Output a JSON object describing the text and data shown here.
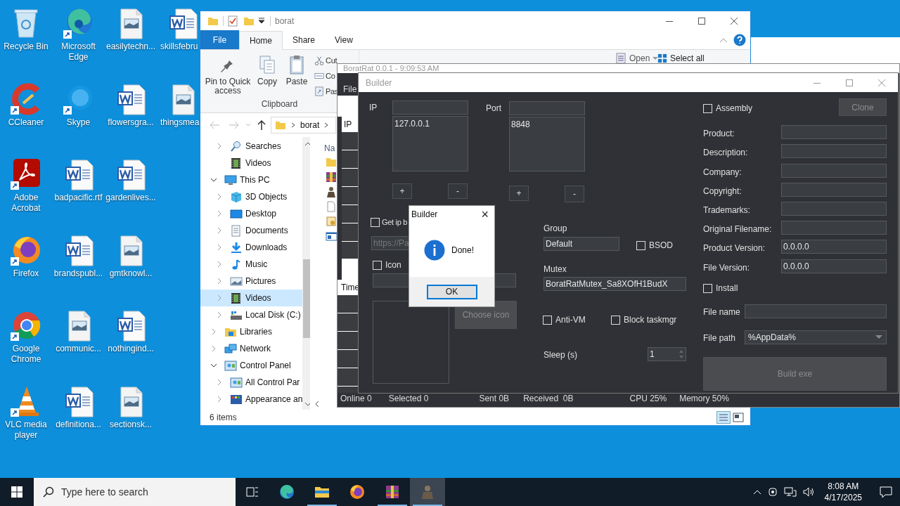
{
  "desktop": {
    "columns": [
      [
        {
          "label": "Recycle Bin",
          "kind": "recycle-bin",
          "shortcut": false
        },
        {
          "label": "CCleaner",
          "kind": "ccleaner",
          "shortcut": true
        },
        {
          "label": "Adobe Acrobat",
          "kind": "acrobat",
          "shortcut": true
        },
        {
          "label": "Firefox",
          "kind": "firefox",
          "shortcut": true
        },
        {
          "label": "Google Chrome",
          "kind": "chrome",
          "shortcut": true
        },
        {
          "label": "VLC media player",
          "kind": "vlc",
          "shortcut": true
        }
      ],
      [
        {
          "label": "Microsoft Edge",
          "kind": "edge",
          "shortcut": true
        },
        {
          "label": "Skype",
          "kind": "skype",
          "shortcut": true
        },
        {
          "label": "badpacific.rtf",
          "kind": "word",
          "shortcut": false
        },
        {
          "label": "brandspubl...",
          "kind": "word",
          "shortcut": false
        },
        {
          "label": "communic...",
          "kind": "image",
          "shortcut": false
        },
        {
          "label": "definitiona...",
          "kind": "word",
          "shortcut": false
        }
      ],
      [
        {
          "label": "easilytechn...",
          "kind": "image",
          "shortcut": false
        },
        {
          "label": "flowersgra...",
          "kind": "word",
          "shortcut": false
        },
        {
          "label": "gardenlives...",
          "kind": "word",
          "shortcut": false
        },
        {
          "label": "gmtknowl...",
          "kind": "image",
          "shortcut": false
        },
        {
          "label": "nothingind...",
          "kind": "word",
          "shortcut": false
        },
        {
          "label": "sectionsk...",
          "kind": "image",
          "shortcut": false
        }
      ],
      [
        {
          "label": "skillsfebru",
          "kind": "word",
          "shortcut": false
        },
        {
          "label": "thingsmea",
          "kind": "image",
          "shortcut": false
        }
      ]
    ]
  },
  "explorer": {
    "title": "borat",
    "tabs": [
      {
        "label": "File",
        "kind": "file",
        "selected": false
      },
      {
        "label": "Home",
        "kind": "tab",
        "selected": true
      },
      {
        "label": "Share",
        "kind": "tab",
        "selected": false
      },
      {
        "label": "View",
        "kind": "tab",
        "selected": false
      }
    ],
    "clipboard": {
      "large_buttons": [
        {
          "label": "Pin to Quick access",
          "kind": "pin"
        },
        {
          "label": "Copy",
          "kind": "copy"
        },
        {
          "label": "Paste",
          "kind": "paste"
        }
      ],
      "small_buttons": [
        {
          "label": "Cut",
          "kind": "cut"
        },
        {
          "label": "Co",
          "kind": "copypath"
        },
        {
          "label": "Pas",
          "kind": "shortcut"
        }
      ],
      "group_label": "Clipboard"
    },
    "open_button": "Open",
    "select_all_button": "Select all",
    "address": "borat",
    "quick_access_items": [
      {
        "label": "Searches",
        "kind": "search",
        "has_children": true,
        "expanded": false,
        "selected": false
      },
      {
        "label": "Videos",
        "kind": "video",
        "has_children": false,
        "selected": false
      }
    ],
    "nav_items": [
      {
        "label": "This PC",
        "kind": "pc",
        "has_children": true,
        "expanded": true,
        "selected": false,
        "children": [
          {
            "label": "3D Objects",
            "kind": "cube",
            "has_children": true,
            "expanded": false,
            "selected": false
          },
          {
            "label": "Desktop",
            "kind": "desktop",
            "has_children": true,
            "expanded": false,
            "selected": false
          },
          {
            "label": "Documents",
            "kind": "document",
            "has_children": true,
            "expanded": false,
            "selected": false
          },
          {
            "label": "Downloads",
            "kind": "download",
            "has_children": true,
            "expanded": false,
            "selected": false
          },
          {
            "label": "Music",
            "kind": "music",
            "has_children": true,
            "expanded": false,
            "selected": false
          },
          {
            "label": "Pictures",
            "kind": "picture",
            "has_children": true,
            "expanded": false,
            "selected": false
          },
          {
            "label": "Videos",
            "kind": "video",
            "has_children": true,
            "expanded": false,
            "selected": true
          },
          {
            "label": "Local Disk (C:)",
            "kind": "disk",
            "has_children": true,
            "expanded": false,
            "selected": false
          }
        ]
      },
      {
        "label": "Libraries",
        "kind": "library",
        "has_children": true,
        "expanded": false,
        "selected": false
      },
      {
        "label": "Network",
        "kind": "network",
        "has_children": true,
        "expanded": false,
        "selected": false
      },
      {
        "label": "Control Panel",
        "kind": "control",
        "has_children": true,
        "expanded": true,
        "selected": false,
        "children": [
          {
            "label": "All Control Par",
            "kind": "control",
            "has_children": true,
            "expanded": false,
            "selected": false
          },
          {
            "label": "Appearance an",
            "kind": "appearance",
            "has_children": true,
            "expanded": false,
            "selected": false
          }
        ]
      }
    ],
    "column_header": "Na",
    "files": [
      {
        "kind": "folder"
      },
      {
        "kind": "archive"
      },
      {
        "kind": "person"
      },
      {
        "kind": "blank"
      },
      {
        "kind": "setup"
      },
      {
        "kind": "window"
      }
    ],
    "status": "6 items"
  },
  "rat_window": {
    "title": "BoratRat 0.0.1 - 9:09:53 AM",
    "menu": "File",
    "list_header": "IP",
    "log_header": "Time",
    "status_bar": [
      "Online 0",
      "Selected 0",
      "Sent 0B",
      "Received  0B",
      "CPU 25%",
      "Memory 50%"
    ]
  },
  "builder": {
    "title": "Builder",
    "ip_label": "IP",
    "ip_list": [
      "127.0.0.1"
    ],
    "port_label": "Port",
    "port_list": [
      "8848"
    ],
    "add_button": "+",
    "remove_button": "-",
    "get_ip": {
      "label": "Get ip b",
      "checked": false
    },
    "url_placeholder": "https://Pa",
    "icon": {
      "label": "Icon",
      "checked": false
    },
    "choose_icon_button": "Choose icon",
    "group_label": "Group",
    "group_value": "Default",
    "bsod": {
      "label": "BSOD",
      "checked": false
    },
    "mutex_label": "Mutex",
    "mutex_value": "BoratRatMutex_Sa8XOfH1BudX",
    "anti_vm": {
      "label": "Anti-VM",
      "checked": false
    },
    "block_taskmgr": {
      "label": "Block taskmgr",
      "checked": false
    },
    "sleep_label": "Sleep (s)",
    "sleep_value": "1",
    "assembly": {
      "label": "Assembly",
      "checked": false
    },
    "clone_button": "Clone",
    "info_fields": [
      {
        "label": "Product:"
      },
      {
        "label": "Description:"
      },
      {
        "label": "Company:"
      },
      {
        "label": "Copyright:"
      },
      {
        "label": "Trademarks:"
      },
      {
        "label": "Original Filename:"
      },
      {
        "label": "Product Version:",
        "value": "0.0.0.0"
      },
      {
        "label": "File Version:",
        "value": "0.0.0.0"
      }
    ],
    "install": {
      "label": "Install",
      "checked": false
    },
    "file_name_label": "File name",
    "file_path_label": "File path",
    "file_path_value": "%AppData%",
    "build_button": "Build exe"
  },
  "message_box": {
    "title": "Builder",
    "close": "×",
    "message": "Done!",
    "ok_button": "OK"
  },
  "taskbar": {
    "search_placeholder": "Type here to search",
    "apps": [
      {
        "kind": "edge",
        "running": false,
        "selected": false
      },
      {
        "kind": "explorer",
        "running": true,
        "selected": false
      },
      {
        "kind": "firefox",
        "running": false,
        "selected": false
      },
      {
        "kind": "archive",
        "running": true,
        "selected": false
      },
      {
        "kind": "person",
        "running": true,
        "selected": true
      }
    ],
    "time": "8:08 AM",
    "date": "4/17/2025"
  }
}
